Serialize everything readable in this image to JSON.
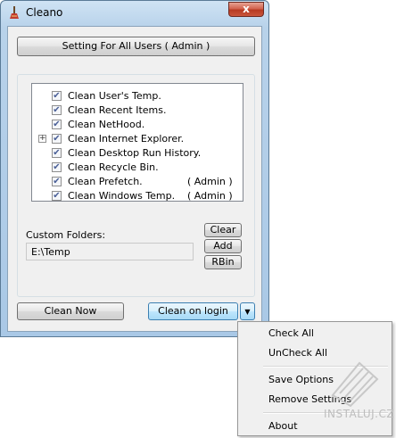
{
  "window": {
    "title": "Cleano",
    "close_glyph": "x",
    "app_icon": "broom-icon"
  },
  "setting_button": "Setting For All Users  ( Admin )",
  "tree": {
    "items": [
      {
        "label": "Clean User's Temp.",
        "checked": true,
        "suffix": "",
        "expandable": false
      },
      {
        "label": "Clean Recent Items.",
        "checked": true,
        "suffix": "",
        "expandable": false
      },
      {
        "label": "Clean NetHood.",
        "checked": true,
        "suffix": "",
        "expandable": false
      },
      {
        "label": "Clean Internet Explorer.",
        "checked": true,
        "suffix": "",
        "expandable": true
      },
      {
        "label": "Clean Desktop Run History.",
        "checked": true,
        "suffix": "",
        "expandable": false
      },
      {
        "label": "Clean Recycle Bin.",
        "checked": true,
        "suffix": "",
        "expandable": false
      },
      {
        "label": "Clean Prefetch.",
        "checked": true,
        "suffix": "( Admin )",
        "expandable": false
      },
      {
        "label": "Clean Windows Temp.",
        "checked": true,
        "suffix": "( Admin )",
        "expandable": false
      }
    ],
    "check_glyph": "✔",
    "expand_glyph": "+"
  },
  "custom_folders": {
    "label": "Custom Folders:",
    "value": "E:\\Temp",
    "clear": "Clear",
    "add": "Add",
    "rbin": "RBin"
  },
  "bottom": {
    "clean_now": "Clean  Now",
    "clean_on_login": "Clean on login",
    "dropdown_glyph": "▼"
  },
  "menu": {
    "items": [
      "Check All",
      "UnCheck All",
      "Save Options",
      "Remove Settings",
      "About"
    ]
  },
  "watermark": "INSTALUJ.CZ"
}
